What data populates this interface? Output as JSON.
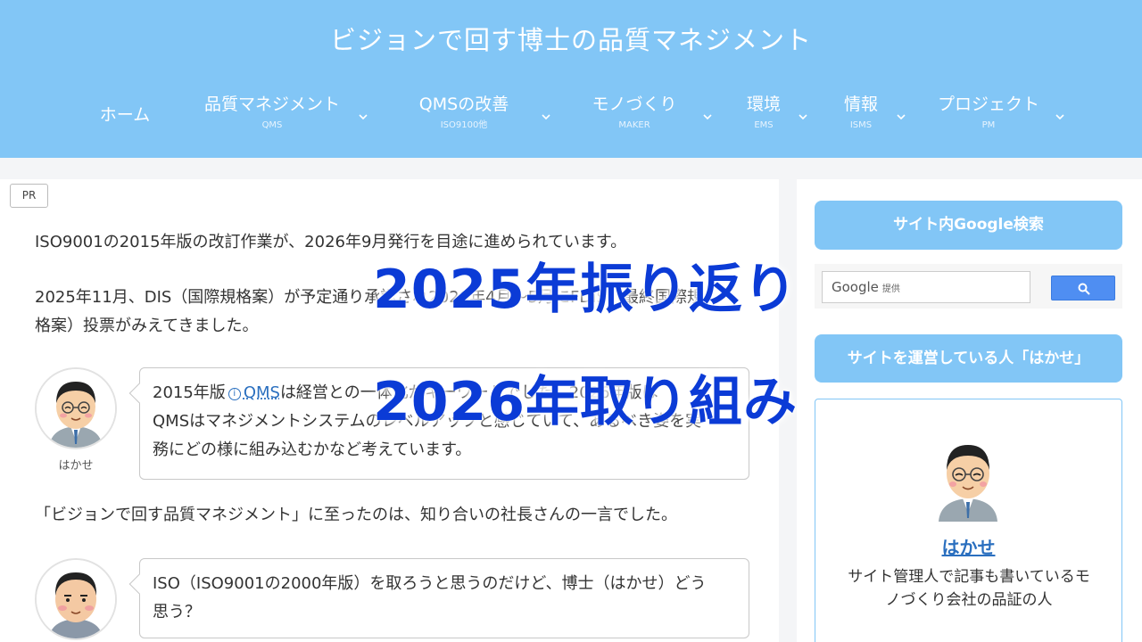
{
  "header": {
    "site_title": "ビジョンで回す博士の品質マネジメント",
    "nav": [
      {
        "label": "ホーム",
        "sub": ""
      },
      {
        "label": "品質マネジメント",
        "sub": "QMS"
      },
      {
        "label": "QMSの改善",
        "sub": "ISO9100他"
      },
      {
        "label": "モノづくり",
        "sub": "MAKER"
      },
      {
        "label": "環境",
        "sub": "EMS"
      },
      {
        "label": "情報",
        "sub": "ISMS"
      },
      {
        "label": "プロジェクト",
        "sub": "PM"
      }
    ]
  },
  "main": {
    "pr_badge": "PR",
    "para1": "ISO9001の2015年版の改訂作業が、2026年9月発行を目途に進められています。",
    "para2_line1": "2025年11月、DIS（国際規格案）が予定通り承認され2026年4月〜5月にFDIS（最終国際規",
    "para2_line2": "格案）投票がみえてきました。",
    "bubble1": {
      "pre": "2015年版",
      "link": "QMS",
      "post": "は経営との一体化がキーワードでした。2026年版は",
      "line2": "QMSはマネジメントシステムのレベルアップと感じていて、あるべき姿を実",
      "line3": "務にどの様に組み込むかなど考えています。"
    },
    "avatar1_name": "はかせ",
    "para3": "「ビジョンで回す品質マネジメント」に至ったのは、知り合いの社長さんの一言でした。",
    "bubble2_line1": "ISO（ISO9001の2000年版）を取ろうと思うのだけど、博士（はかせ）どう",
    "bubble2_line2": "思う？"
  },
  "overlay": {
    "line1": "2025年振り返り",
    "line2": "2026年取り組み"
  },
  "sidebar": {
    "search_heading": "サイト内Google検索",
    "google_label": "Google",
    "google_sub": "提供",
    "profile_heading": "サイトを運営している人「はかせ」",
    "profile_name": "はかせ",
    "profile_desc": "サイト管理人で記事も書いているモノづくり会社の品証の人"
  },
  "colors": {
    "header_bg": "#82c6f6",
    "overlay_text": "#0b3bd6",
    "link": "#2a6fbf",
    "search_button": "#4f8ef2"
  }
}
